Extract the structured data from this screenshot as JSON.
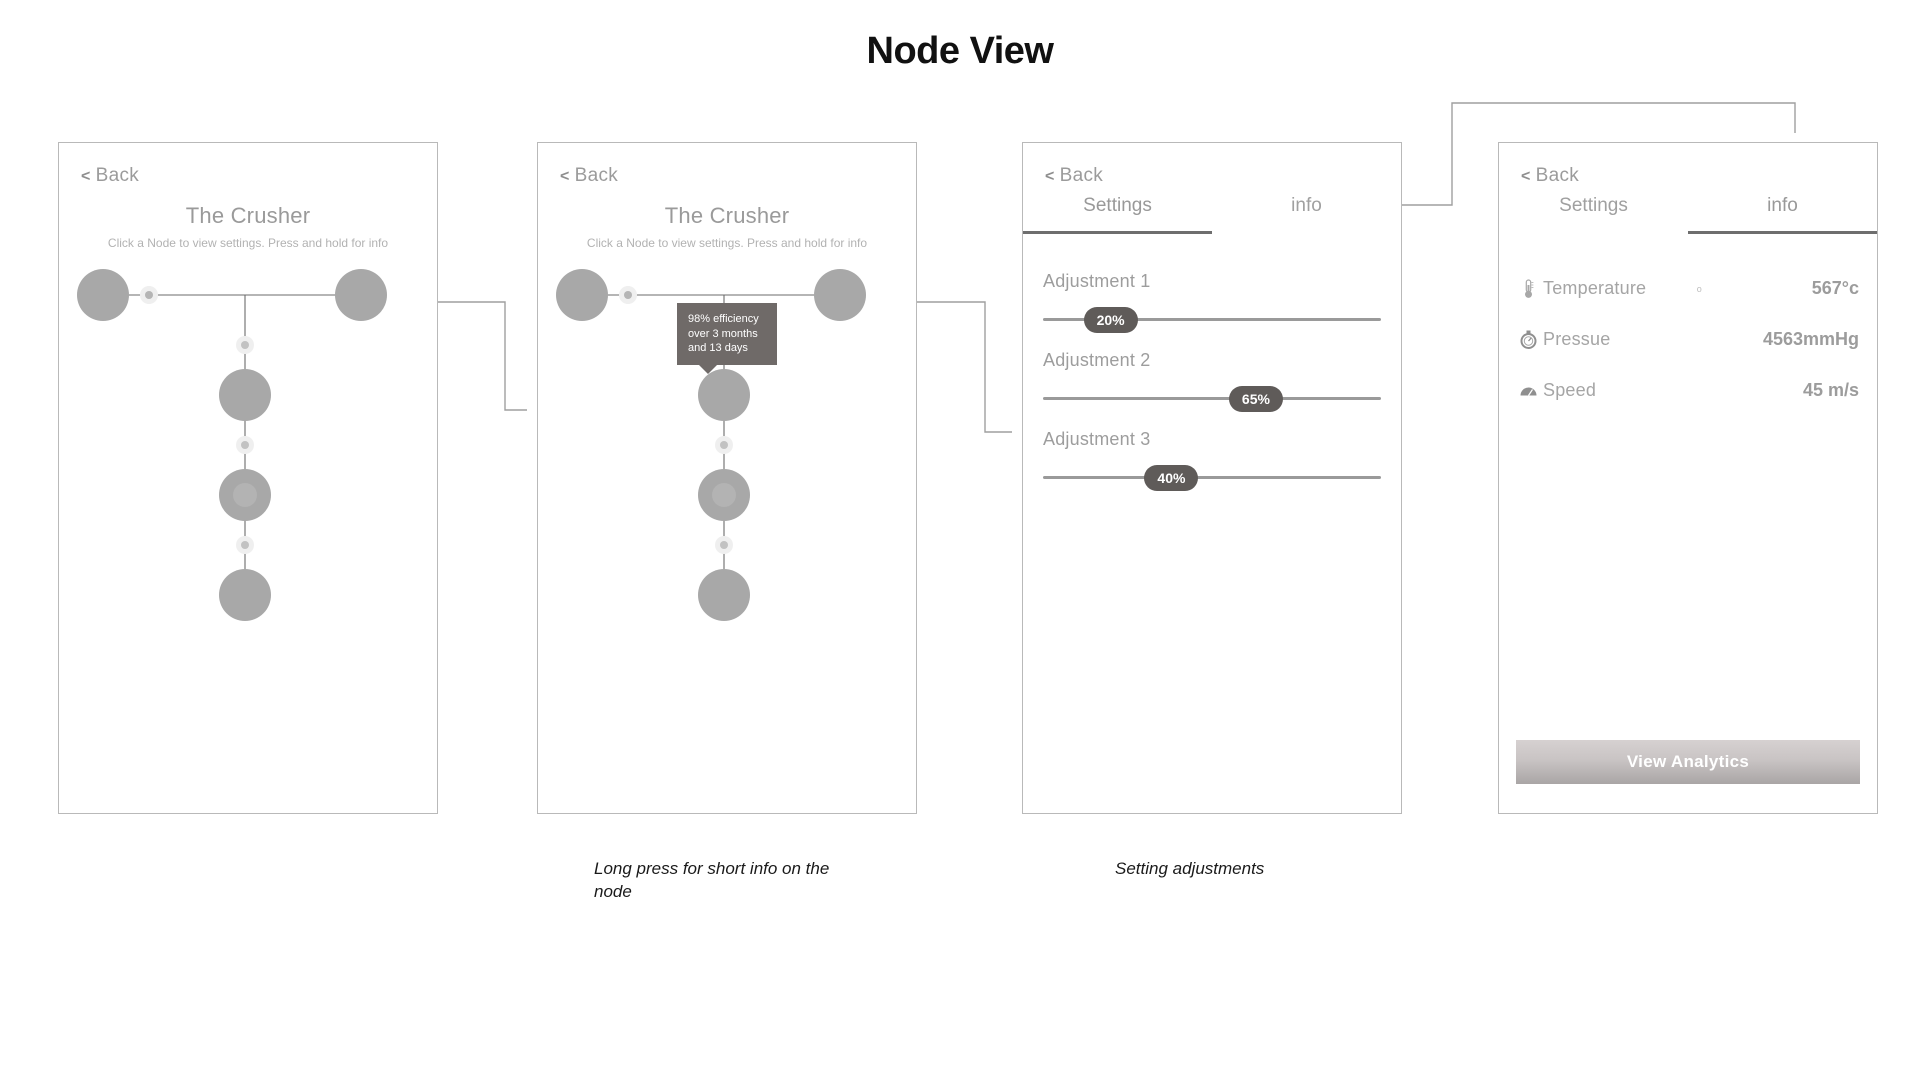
{
  "page": {
    "title": "Node View"
  },
  "common": {
    "back_label": "Back",
    "back_chevron": "<"
  },
  "panel1": {
    "name": "node-graph-panel",
    "title": "The Crusher",
    "subtitle": "Click a Node to view settings. Press and hold for info"
  },
  "panel2": {
    "name": "node-graph-longpress-panel",
    "title": "The Crusher",
    "subtitle": "Click a Node to view settings. Press and hold for info",
    "tooltip": "98% efficiency over 3 months and 13 days"
  },
  "panel3": {
    "name": "settings-panel",
    "tabs": [
      {
        "label": "Settings",
        "active": true
      },
      {
        "label": "info",
        "active": false
      }
    ],
    "adjustments": [
      {
        "label": "Adjustment 1",
        "value": "20%",
        "percent": 20
      },
      {
        "label": "Adjustment 2",
        "value": "65%",
        "percent": 65
      },
      {
        "label": "Adjustment 3",
        "value": "40%",
        "percent": 40
      }
    ]
  },
  "panel4": {
    "name": "info-panel",
    "tabs": [
      {
        "label": "Settings",
        "active": false
      },
      {
        "label": "info",
        "active": true
      }
    ],
    "degree_mark": "o",
    "metrics": [
      {
        "icon": "thermometer-icon",
        "label": "Temperature",
        "value": "567°c"
      },
      {
        "icon": "pressure-gauge-icon",
        "label": "Pressue",
        "value": "4563mmHg"
      },
      {
        "icon": "speedometer-icon",
        "label": "Speed",
        "value": "45 m/s"
      }
    ],
    "analytics_button": "View Analytics"
  },
  "captions": {
    "caption1": "Long press for short info on the node",
    "caption2": "Setting adjustments"
  },
  "colors": {
    "node_fill": "#a8a8a8",
    "edge": "#6b6b6b",
    "tooltip_bg": "#6f6a68",
    "thumb_bg": "#5f5b59",
    "panel_border": "#b9b9b9",
    "text_muted": "#9b9b9b"
  }
}
